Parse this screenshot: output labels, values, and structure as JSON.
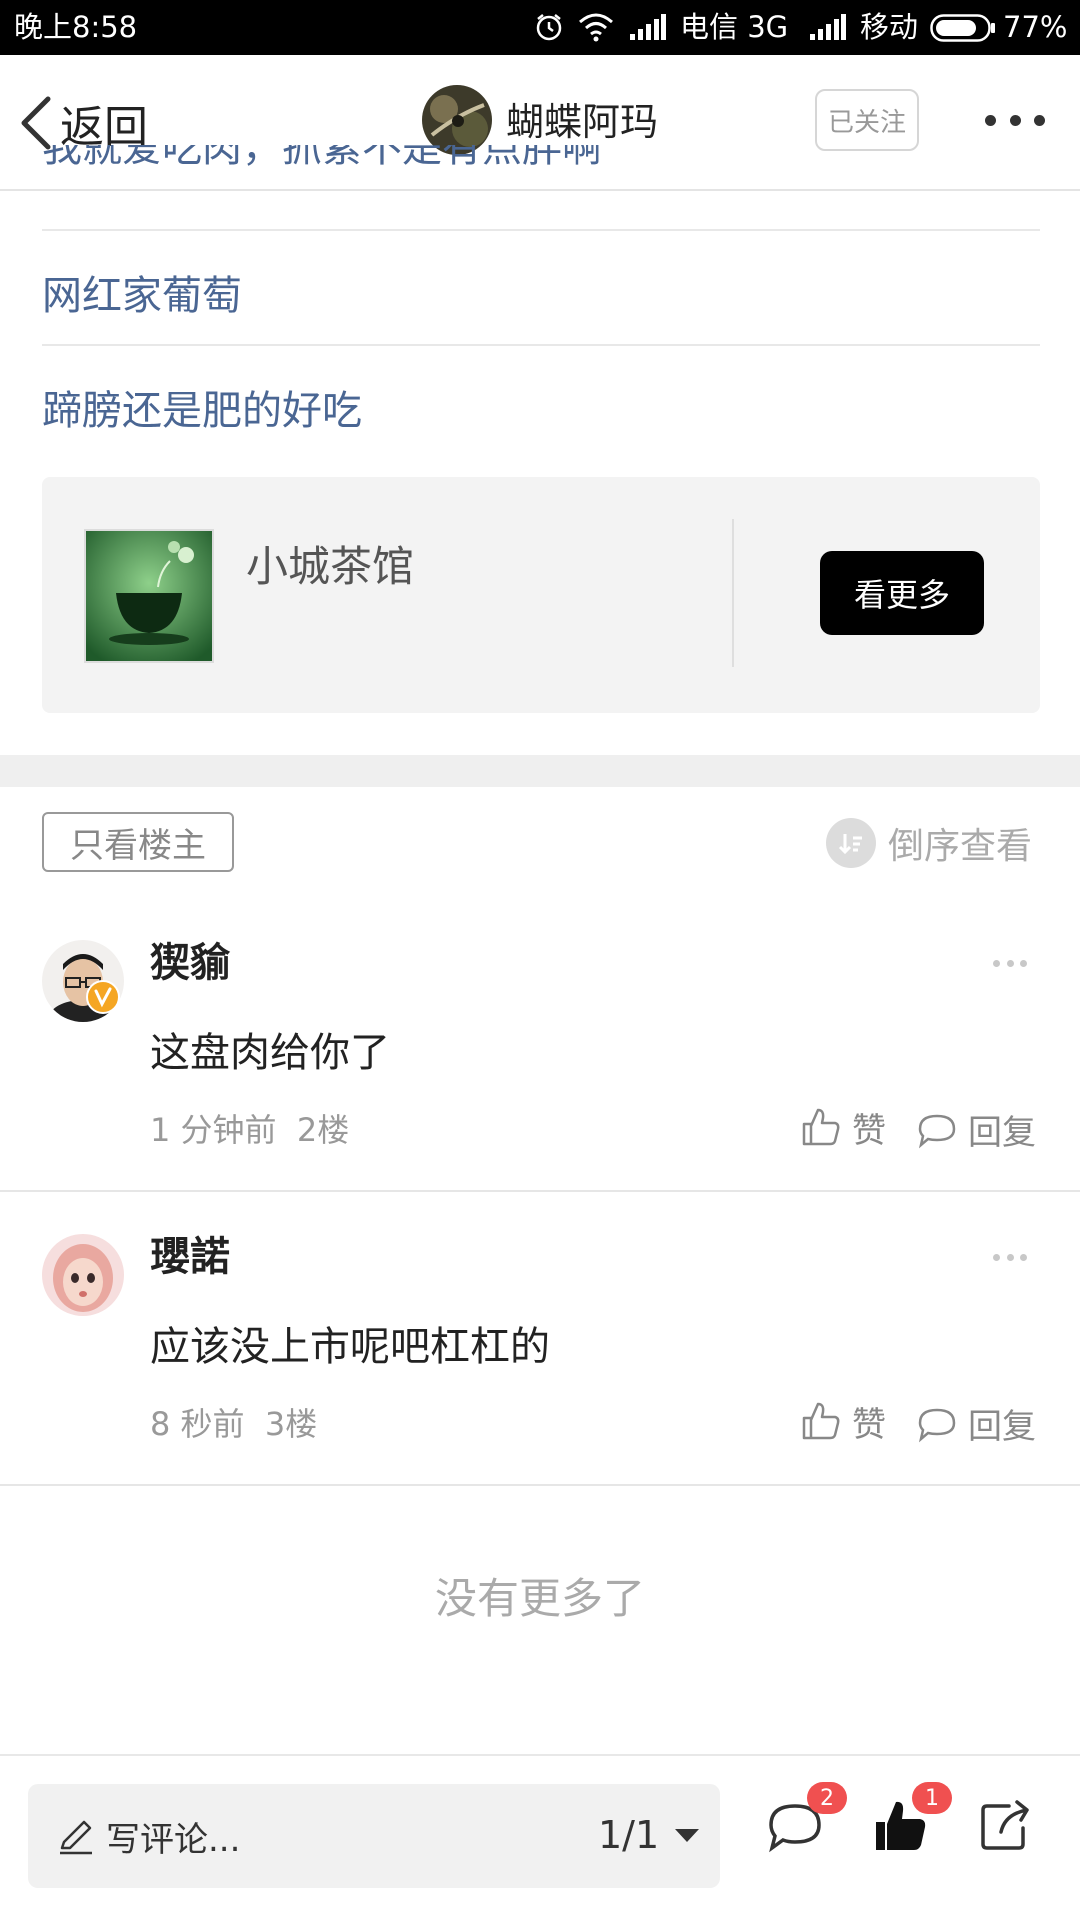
{
  "status_bar": {
    "time": "晚上8:58",
    "carrier1": "电信 3G",
    "carrier2": "移动",
    "battery": "77%"
  },
  "header": {
    "back_label": "返回",
    "author_name": "蝴蝶阿玛",
    "follow_label": "已关注"
  },
  "topics": {
    "cut_text": "我就爱吃肉，抓紧不是有点胖啊",
    "links": [
      "网红家葡萄",
      "蹄膀还是肥的好吃"
    ]
  },
  "card": {
    "title": "小城茶馆",
    "more_label": "看更多"
  },
  "filter": {
    "owner_only_label": "只看楼主",
    "sort_label": "倒序查看"
  },
  "comments": [
    {
      "name": "猰貐",
      "text": "这盘肉给你了",
      "time": "1 分钟前",
      "floor": "2楼",
      "like_label": "赞",
      "reply_label": "回复",
      "verified": true
    },
    {
      "name": "瓔諾",
      "text": "应该没上市呢吧杠杠的",
      "time": "8 秒前",
      "floor": "3楼",
      "like_label": "赞",
      "reply_label": "回复",
      "verified": false
    }
  ],
  "no_more_label": "没有更多了",
  "bottom_bar": {
    "write_placeholder": "写评论...",
    "page_indicator": "1/1",
    "comment_count": "2",
    "like_count": "1"
  },
  "colors": {
    "link": "#4a6693",
    "badge": "#f05050",
    "verified": "#f5a623"
  }
}
